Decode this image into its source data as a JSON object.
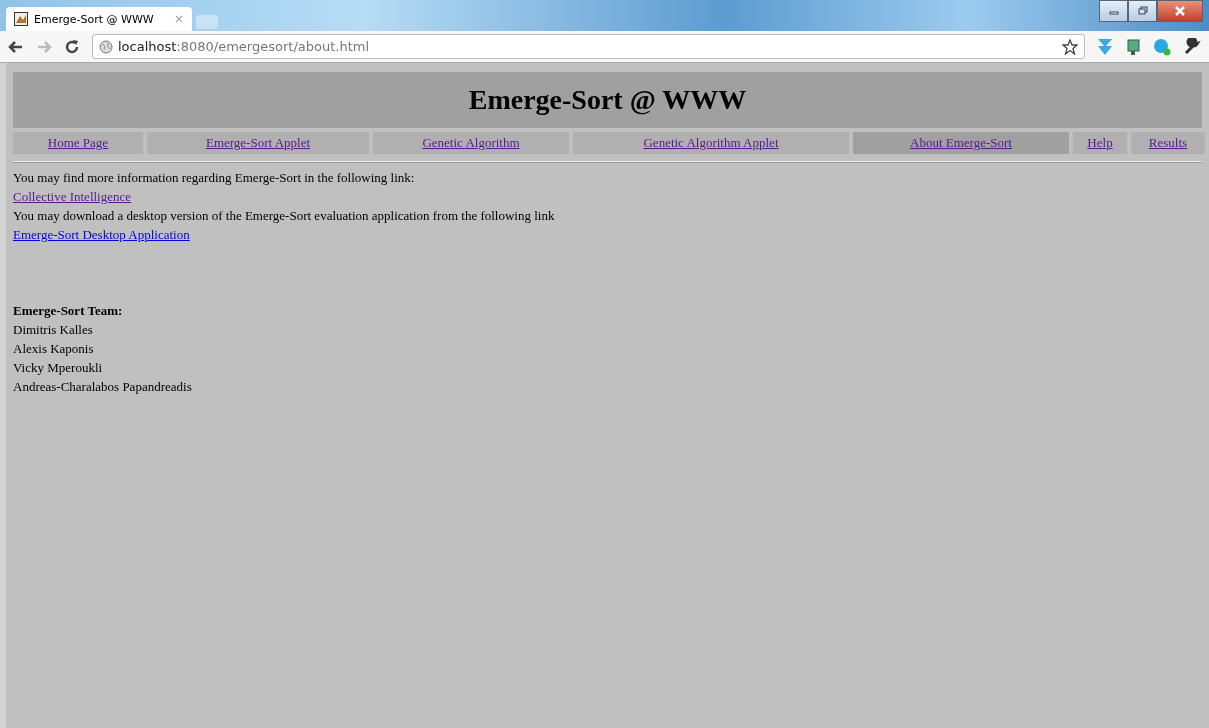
{
  "tab": {
    "title": "Emerge-Sort @ WWW",
    "close": "×"
  },
  "address": {
    "host": "localhost",
    "path": ":8080/emergesort/about.html"
  },
  "page": {
    "heading": "Emerge-Sort @ WWW",
    "nav": [
      {
        "label": "Home Page",
        "selected": false
      },
      {
        "label": "Emerge-Sort Applet",
        "selected": false
      },
      {
        "label": "Genetic Algorithm",
        "selected": false
      },
      {
        "label": "Genetic Algorithm Applet",
        "selected": false
      },
      {
        "label": "About Emerge-Sort",
        "selected": true
      },
      {
        "label": "Help",
        "selected": false
      },
      {
        "label": "Results",
        "selected": false
      }
    ],
    "lines": [
      {
        "kind": "text",
        "text": "You may find more information regarding Emerge-Sort in the following link:"
      },
      {
        "kind": "link",
        "text": "Collective Intelligence",
        "visited": true
      },
      {
        "kind": "text",
        "text": "You may download a desktop version of the Emerge-Sort evaluation application from the following link"
      },
      {
        "kind": "link",
        "text": "Emerge-Sort Desktop Application",
        "visited": false
      }
    ],
    "team_title": "Emerge-Sort Team:",
    "team": [
      "Dimitris Kalles",
      "Alexis Kaponis",
      "Vicky Mperoukli",
      "Andreas-Charalabos Papandreadis"
    ]
  }
}
